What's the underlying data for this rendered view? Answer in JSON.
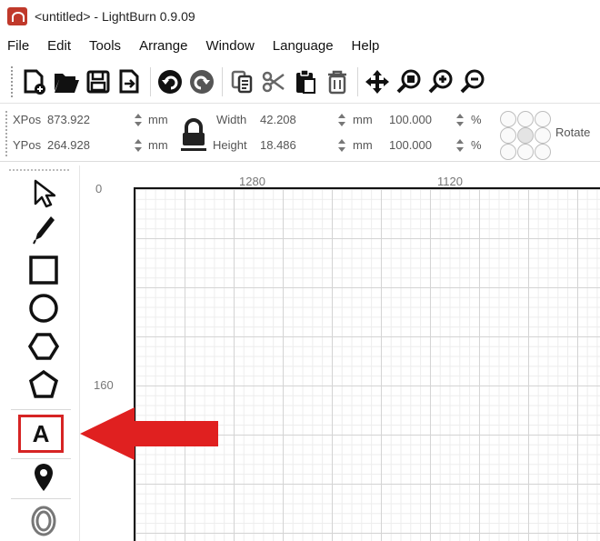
{
  "window": {
    "title": "<untitled> - LightBurn 0.9.09"
  },
  "menu": [
    "File",
    "Edit",
    "Tools",
    "Arrange",
    "Window",
    "Language",
    "Help"
  ],
  "toolbar": {
    "icons": [
      "new-file-icon",
      "open-folder-icon",
      "save-icon",
      "import-icon",
      "undo-icon",
      "redo-icon",
      "copy-icon",
      "cut-icon",
      "paste-icon",
      "delete-icon",
      "move-icon",
      "zoom-to-page-icon",
      "zoom-in-icon",
      "zoom-out-icon"
    ]
  },
  "properties": {
    "xpos_label": "XPos",
    "xpos_value": "873.922",
    "ypos_label": "YPos",
    "ypos_value": "264.928",
    "unit_mm": "mm",
    "width_label": "Width",
    "width_value": "42.208",
    "height_label": "Height",
    "height_value": "18.486",
    "scale_x": "100.000",
    "scale_y": "100.000",
    "percent": "%",
    "rotate_label": "Rotate"
  },
  "tools": [
    "select-tool",
    "edit-nodes-tool",
    "rectangle-tool",
    "ellipse-tool",
    "polygon-tool",
    "pentagon-tool",
    "text-tool",
    "position-laser-tool",
    "offset-tool"
  ],
  "text_tool_label": "A",
  "ruler": {
    "top": [
      "1280",
      "1120"
    ],
    "left": [
      "0",
      "160"
    ]
  },
  "annotation": {
    "arrow_color": "#e02020",
    "highlight_color": "#d62424"
  }
}
